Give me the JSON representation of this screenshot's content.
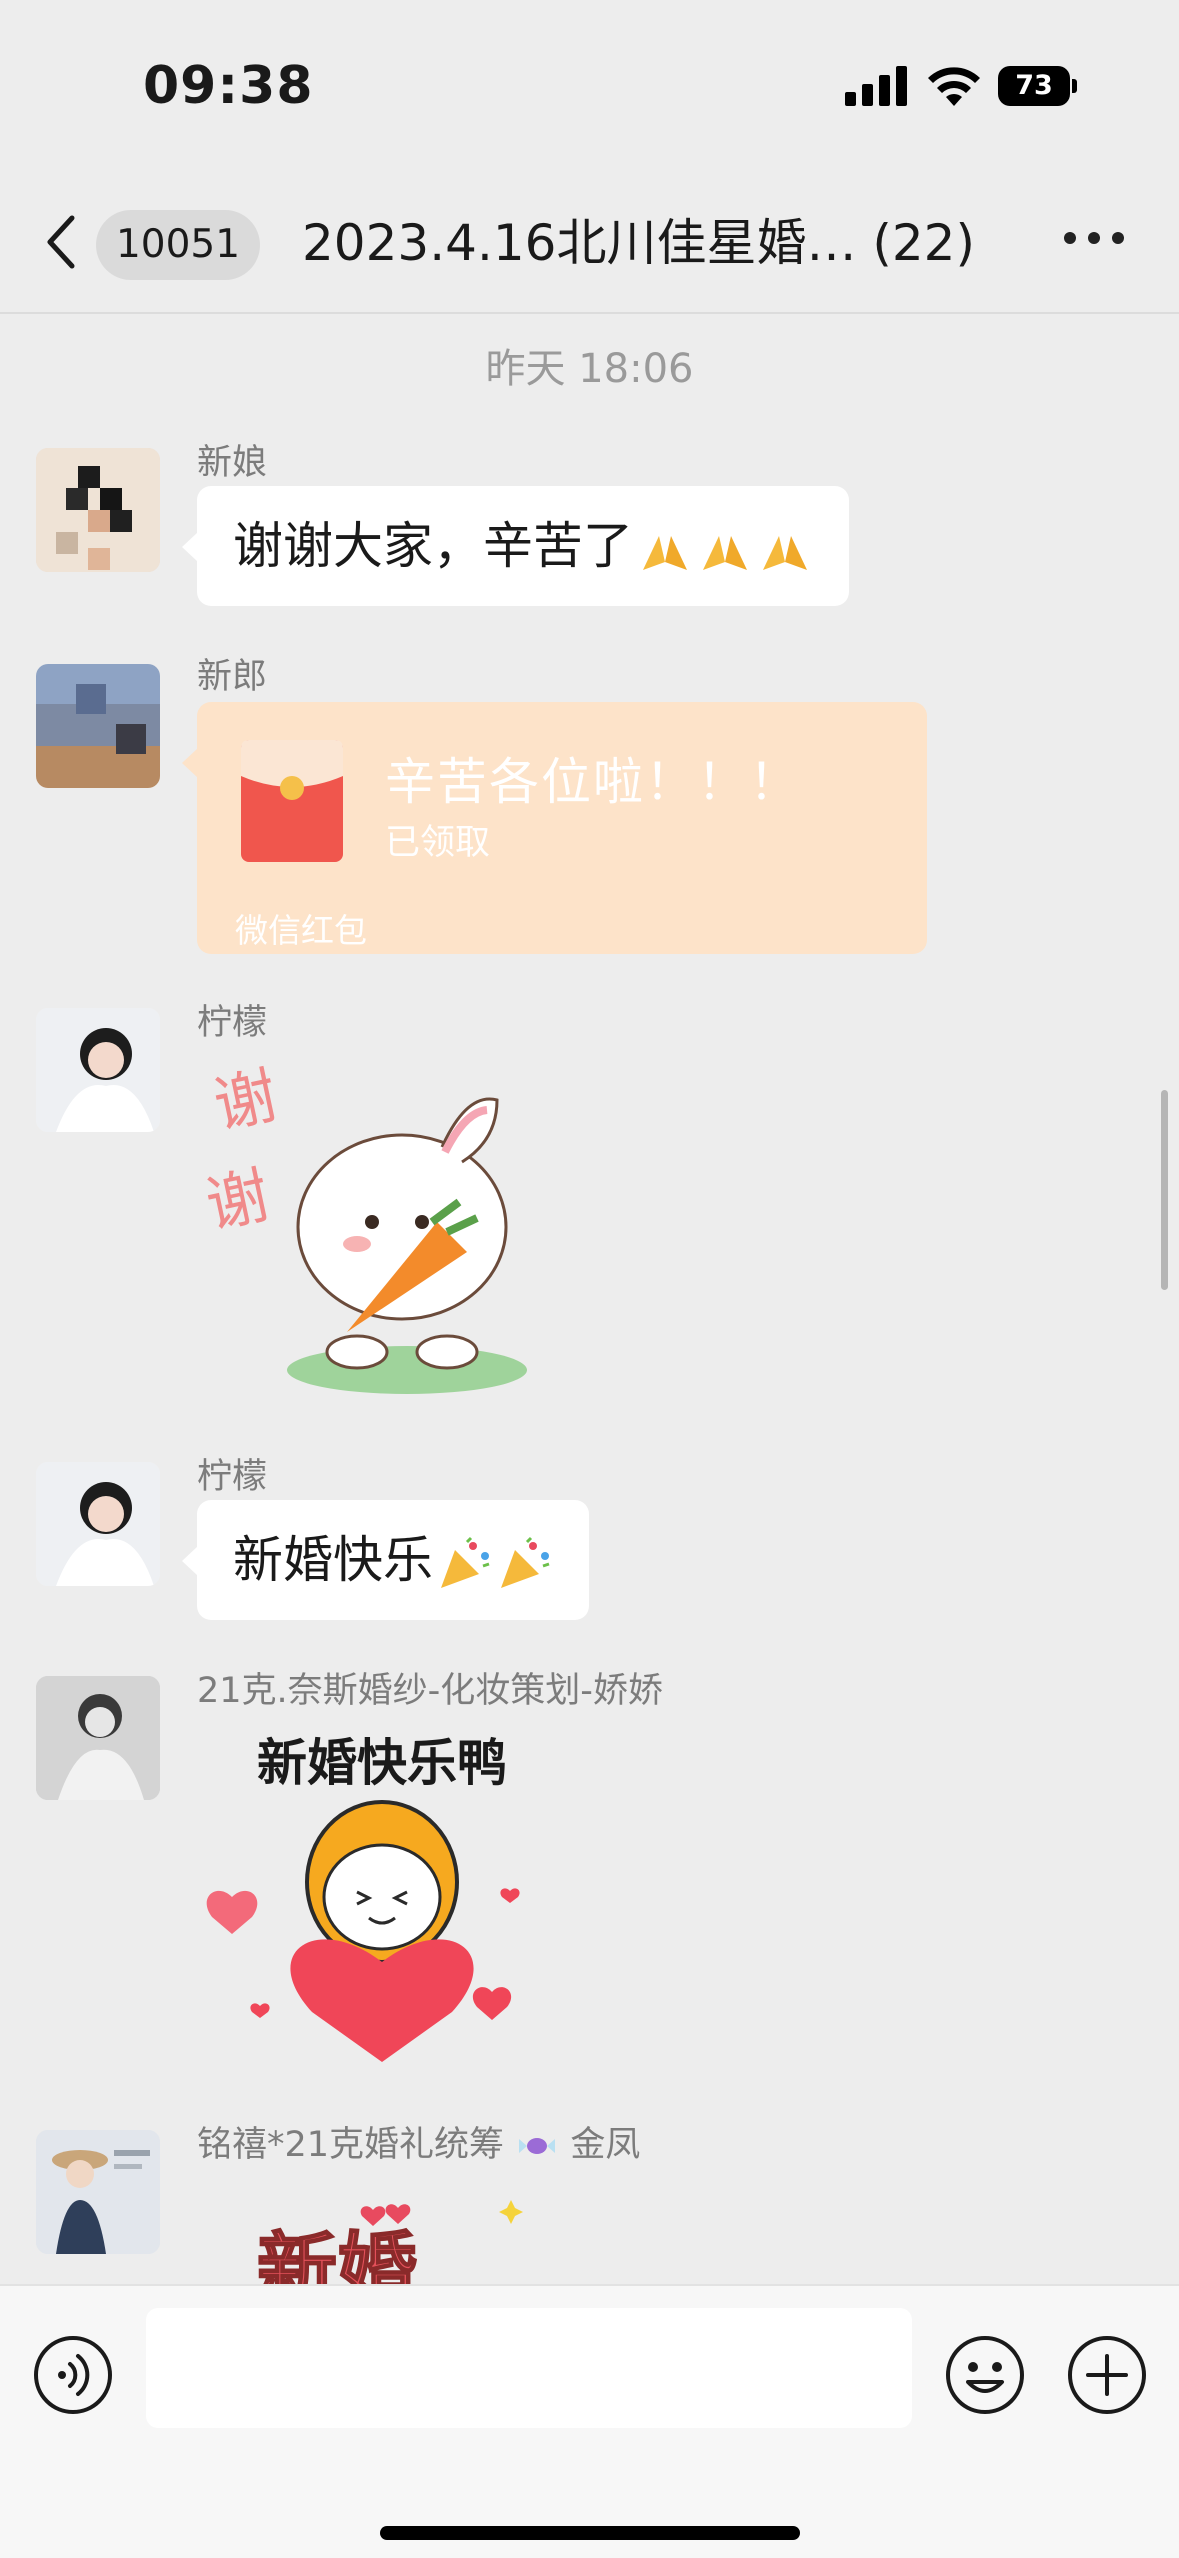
{
  "status_bar": {
    "time": "09:38",
    "battery": "73",
    "icons": [
      "cellular-signal-icon",
      "wifi-icon",
      "battery-icon"
    ]
  },
  "nav": {
    "back_icon": "chevron-left-icon",
    "unread_count": "10051",
    "title": "2023.4.16北川佳星婚… (22)",
    "more_icon": "ellipsis-icon"
  },
  "chat": {
    "timestamp": "昨天 18:06",
    "messages": [
      {
        "sender": "新娘",
        "type": "text",
        "text": "谢谢大家，辛苦了",
        "emoji": "folded-hands-icon"
      },
      {
        "sender": "新郎",
        "type": "red_packet",
        "title": "辛苦各位啦！！！",
        "status": "已领取",
        "footer": "微信红包"
      },
      {
        "sender": "柠檬",
        "type": "sticker",
        "sticker": "rabbit-thanks-sticker",
        "sticker_text": "谢谢"
      },
      {
        "sender": "柠檬",
        "type": "text",
        "text": "新婚快乐",
        "emoji": "party-popper-icon"
      },
      {
        "sender": "21克.奈斯婚纱-化妆策划-娇娇",
        "type": "sticker",
        "sticker": "duck-heart-sticker",
        "sticker_text": "新婚快乐鸭"
      },
      {
        "sender": "铭禧*21克婚礼统筹",
        "sender_suffix": "金凤",
        "type": "sticker",
        "sticker": "newlywed-sticker",
        "sticker_text": "新婚"
      }
    ]
  },
  "input_bar": {
    "voice_icon": "voice-input-icon",
    "input_value": "",
    "emoji_icon": "smiley-icon",
    "plus_icon": "plus-circle-icon"
  },
  "colors": {
    "background": "#ededed",
    "bubble": "#ffffff",
    "red_packet": "#fde3c9",
    "red_packet_icon": "#f0564d"
  }
}
